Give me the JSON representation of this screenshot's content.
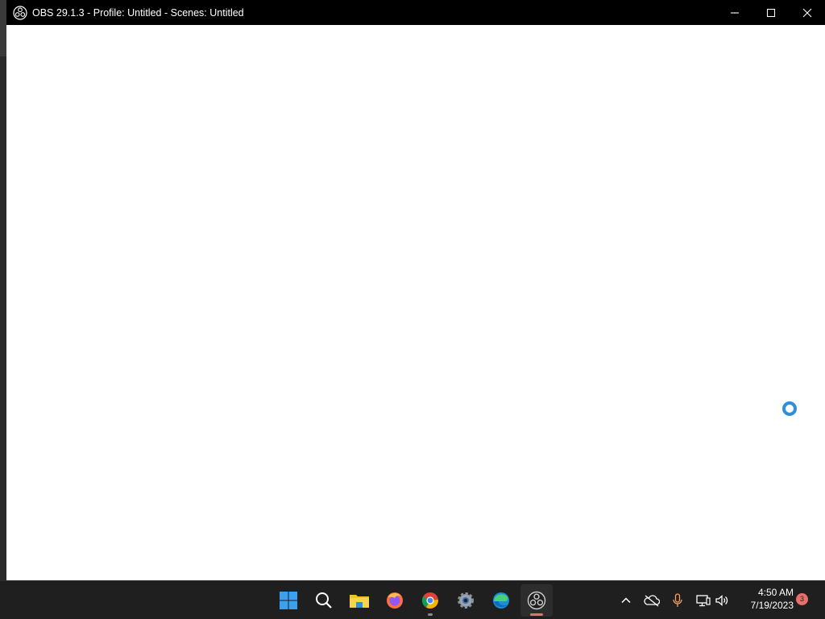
{
  "window": {
    "app": "OBS",
    "title": "OBS 29.1.3 - Profile: Untitled - Scenes: Untitled",
    "controls": {
      "minimize_icon": "minimize-icon",
      "maximize_icon": "maximize-icon",
      "close_icon": "close-icon"
    }
  },
  "colors": {
    "titlebar_bg": "#000000",
    "client_bg": "#ffffff",
    "taskbar_bg": "#1f1f1f",
    "spinner": "#2f8fd9",
    "accent_running": "#e8706a"
  },
  "taskbar": {
    "pinned": [
      {
        "icon": "windows-start-icon"
      },
      {
        "icon": "search-icon"
      },
      {
        "icon": "file-explorer-icon"
      },
      {
        "icon": "firefox-icon"
      },
      {
        "icon": "chrome-icon",
        "running": true
      },
      {
        "icon": "settings-gear-icon"
      },
      {
        "icon": "edge-icon"
      },
      {
        "icon": "obs-icon",
        "running": true,
        "active": true
      }
    ],
    "tray": {
      "icons": [
        "chevron-up-icon",
        "onedrive-offline-icon",
        "microphone-icon",
        "network-icon",
        "volume-icon"
      ],
      "time": "4:50 AM",
      "date": "7/19/2023",
      "notification_count": "3"
    }
  }
}
